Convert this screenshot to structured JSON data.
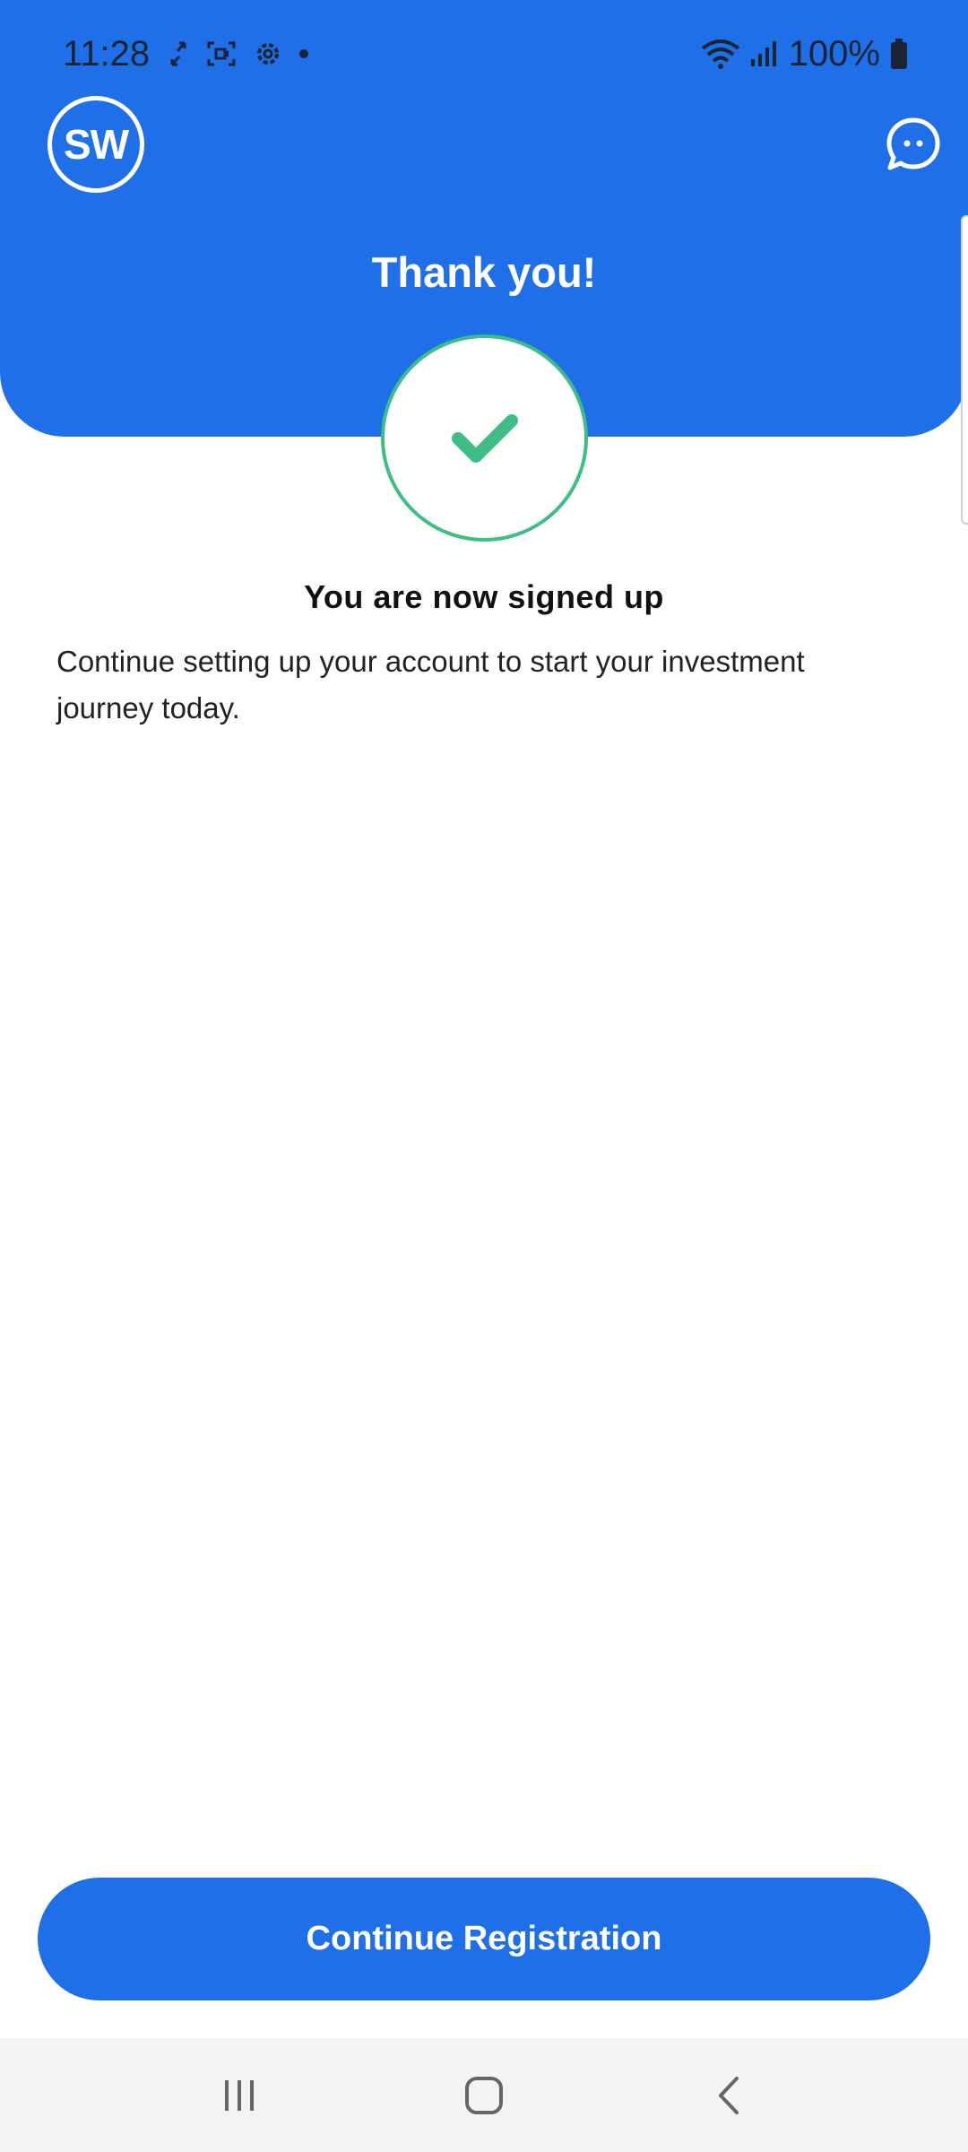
{
  "status_bar": {
    "time": "11:28",
    "battery": "100%"
  },
  "header": {
    "logo_text": "SW",
    "title": "Thank you!"
  },
  "main": {
    "heading": "You are now signed up",
    "description": "Continue setting up your account to start your investment journey today."
  },
  "footer": {
    "primary_button": "Continue Registration"
  },
  "icons": {
    "chat": "chat-bubble-icon",
    "success": "checkmark-icon"
  },
  "colors": {
    "brand_blue": "#1f6fe9",
    "success_green": "#3ebd85"
  }
}
